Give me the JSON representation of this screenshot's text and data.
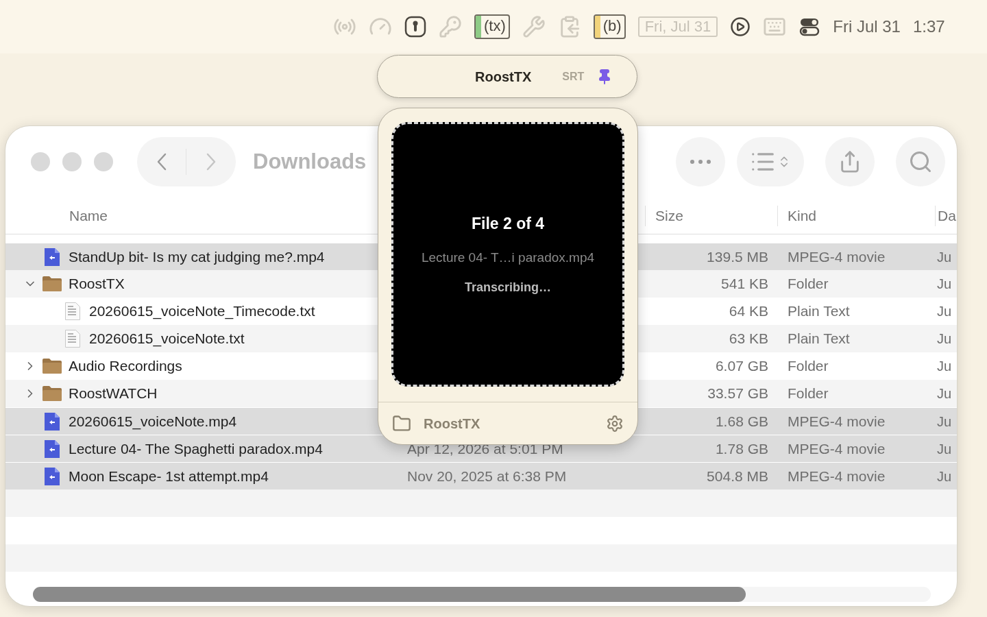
{
  "menu_bar": {
    "items": [
      {
        "kind": "radio",
        "dimmed": true
      },
      {
        "kind": "gauge",
        "dimmed": true
      },
      {
        "kind": "keyhole",
        "dimmed": false
      },
      {
        "kind": "keys",
        "dimmed": true
      },
      {
        "kind": "badge",
        "text": "(tx)",
        "color": "#8ecb86",
        "dimmed": false
      },
      {
        "kind": "tools",
        "dimmed": true
      },
      {
        "kind": "clipboard",
        "dimmed": true
      },
      {
        "kind": "badge",
        "text": "(b)",
        "color": "#f2d47c",
        "dimmed": false
      },
      {
        "kind": "date",
        "text": "Fri, Jul 31",
        "dimmed": true
      },
      {
        "kind": "play",
        "dimmed": false
      },
      {
        "kind": "keyboard",
        "dimmed": true
      },
      {
        "kind": "toggles",
        "dimmed": false
      },
      {
        "kind": "clock",
        "text": "Fri Jul 31",
        "dimmed": false
      },
      {
        "kind": "clock",
        "text": "1:37",
        "dimmed": false
      }
    ]
  },
  "finder": {
    "title": "Downloads",
    "columns": [
      {
        "label": "Name"
      },
      {},
      {
        "label": "Size"
      },
      {
        "label": "Kind"
      },
      {
        "label": "Da"
      }
    ],
    "rows": [
      {
        "name": "StandUp bit- Is my cat judging me?.mp4",
        "kind": "movie",
        "size": "139.5 MB",
        "kind_text": "MPEG-4 movie",
        "date_added": "Ju",
        "selected": true
      },
      {
        "name": "RoostTX",
        "kind": "folder",
        "expanded": true,
        "size": "541 KB",
        "kind_text": "Folder",
        "date_added": "Ju",
        "selected": false,
        "children": [
          {
            "name": "20260615_voiceNote_Timecode.txt",
            "kind": "text",
            "size": "64 KB",
            "kind_text": "Plain Text",
            "date_added": "Ju",
            "selected": false
          },
          {
            "name": "20260615_voiceNote.txt",
            "kind": "text",
            "size": "63 KB",
            "kind_text": "Plain Text",
            "date_added": "Ju",
            "selected": false
          }
        ]
      },
      {
        "name": "Audio Recordings",
        "kind": "folder",
        "expanded": false,
        "size": "6.07 GB",
        "kind_text": "Folder",
        "date_added": "Ju",
        "selected": false
      },
      {
        "name": "RoostWATCH",
        "kind": "folder",
        "expanded": false,
        "size": "33.57 GB",
        "kind_text": "Folder",
        "date_added": "Ju",
        "selected": false
      },
      {
        "name": "20260615_voiceNote.mp4",
        "kind": "movie",
        "size": "1.68 GB",
        "kind_text": "MPEG-4 movie",
        "date_added": "Ju",
        "selected": true
      },
      {
        "name": "Lecture 04- The Spaghetti paradox.mp4",
        "kind": "movie",
        "date_modified": "Apr 12, 2026 at 5:01 PM",
        "size": "1.78 GB",
        "kind_text": "MPEG-4 movie",
        "date_added": "Ju",
        "selected": true
      },
      {
        "name": "Moon Escape- 1st attempt.mp4",
        "kind": "movie",
        "date_modified": "Nov 20, 2025 at 6:38 PM",
        "size": "504.8 MB",
        "kind_text": "MPEG-4 movie",
        "date_added": "Ju",
        "selected": true
      }
    ]
  },
  "popover": {
    "title": "RoostTX",
    "format": "SRT",
    "pinned": true,
    "progress": "File 2 of 4",
    "file": "Lecture 04- T…i paradox.mp4",
    "status": "Transcribing…",
    "folder": "RoostTX"
  }
}
